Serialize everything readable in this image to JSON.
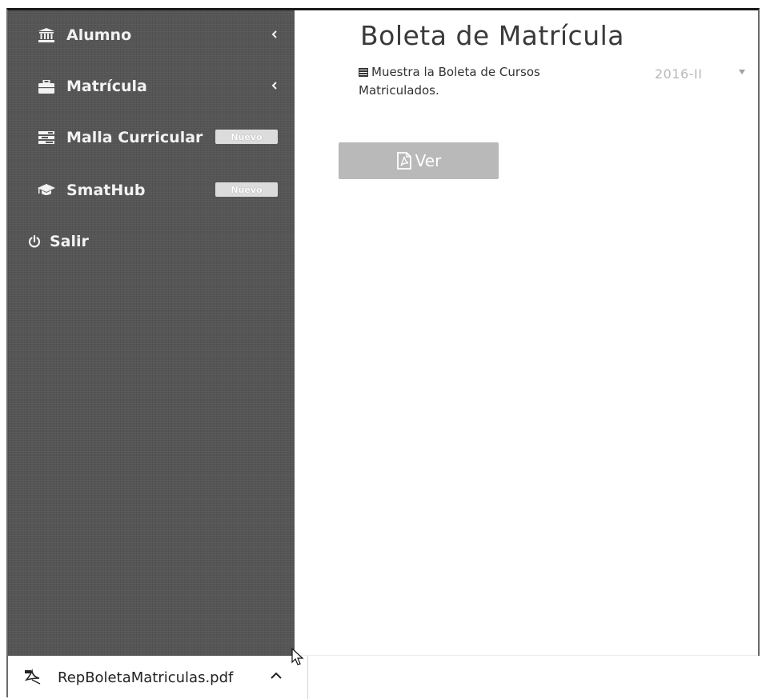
{
  "sidebar": {
    "items": [
      {
        "label": "Alumno",
        "icon": "institution-icon",
        "has_chevron": true
      },
      {
        "label": "Matrícula",
        "icon": "briefcase-icon",
        "has_chevron": true
      },
      {
        "label": "Malla Curricular",
        "icon": "tasks-icon",
        "badge": "Nuevo"
      },
      {
        "label": "SmatHub",
        "icon": "graduation-cap-icon",
        "badge": "Nuevo"
      },
      {
        "label": "Salir",
        "icon": "power-icon"
      }
    ]
  },
  "main": {
    "title": "Boleta de Matrícula",
    "description": "Muestra la Boleta de Cursos Matriculados.",
    "description_icon": "list-icon",
    "term_select": {
      "value": "2016-II"
    },
    "view_button": {
      "label": "Ver",
      "icon": "file-pdf-icon"
    }
  },
  "downloads": {
    "file_name": "RepBoletaMatriculas.pdf",
    "icon": "pdf-file-icon"
  },
  "colors": {
    "sidebar_bg": "#555555",
    "badge_bg": "#dcdcdc",
    "button_bg": "#b9b9b9",
    "title_text": "#3a3a3a"
  }
}
